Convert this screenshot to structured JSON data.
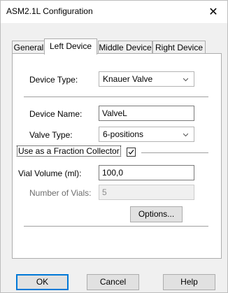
{
  "window": {
    "title": "ASM2.1L Configuration",
    "close_glyph": "✕"
  },
  "tabs": [
    {
      "label": "General"
    },
    {
      "label": "Left Device"
    },
    {
      "label": "Middle Device"
    },
    {
      "label": "Right Device"
    }
  ],
  "active_tab": "Left Device",
  "form": {
    "device_type_label": "Device Type:",
    "device_type_value": "Knauer Valve",
    "device_name_label": "Device Name:",
    "device_name_value": "ValveL",
    "valve_type_label": "Valve Type:",
    "valve_type_value": "6-positions",
    "fraction_collector_label": "Use as a Fraction Collector",
    "fraction_collector_checked": true,
    "vial_volume_label": "Vial Volume (ml):",
    "vial_volume_value": "100,0",
    "num_vials_label": "Number of Vials:",
    "num_vials_value": "5",
    "options_button": "Options..."
  },
  "buttons": {
    "ok": "OK",
    "cancel": "Cancel",
    "help": "Help"
  },
  "colors": {
    "default_button_border": "#0078d7",
    "dialog_bg": "#f0f0f0"
  }
}
